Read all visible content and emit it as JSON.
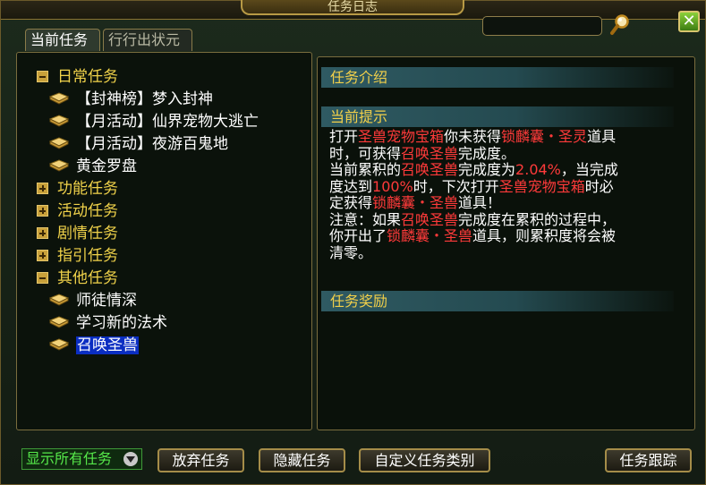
{
  "window": {
    "title": "任务日志"
  },
  "search": {
    "placeholder": ""
  },
  "tabs": [
    {
      "label": "当前任务",
      "active": true
    },
    {
      "label": "行行出状元",
      "active": false
    }
  ],
  "tree": {
    "categories": [
      {
        "label": "日常任务",
        "expanded": true,
        "items": [
          "【封神榜】梦入封神",
          "【月活动】仙界宠物大逃亡",
          "【月活动】夜游百鬼地",
          "黄金罗盘"
        ]
      },
      {
        "label": "功能任务",
        "expanded": false,
        "items": []
      },
      {
        "label": "活动任务",
        "expanded": false,
        "items": []
      },
      {
        "label": "剧情任务",
        "expanded": false,
        "items": []
      },
      {
        "label": "指引任务",
        "expanded": false,
        "items": []
      },
      {
        "label": "其他任务",
        "expanded": true,
        "items": [
          "师徒情深",
          "学习新的法术",
          "召唤圣兽"
        ]
      }
    ],
    "selected_item": "召唤圣兽"
  },
  "detail": {
    "intro_header": "任务介绍",
    "hint_header": "当前提示",
    "reward_header": "任务奖励",
    "hint_segments": [
      {
        "t": "打开",
        "red": false
      },
      {
        "t": "圣兽宠物宝箱",
        "red": true
      },
      {
        "t": "你未获得",
        "red": false
      },
      {
        "t": "锁麟囊・圣灵",
        "red": true
      },
      {
        "t": "道具时，可获得",
        "red": false
      },
      {
        "t": "召唤圣兽",
        "red": true
      },
      {
        "t": "完成度。",
        "red": false
      },
      {
        "t": "当前累积的",
        "red": false
      },
      {
        "t": "召唤圣兽",
        "red": true
      },
      {
        "t": "完成度为",
        "red": false
      },
      {
        "t": "2.04%",
        "red": true
      },
      {
        "t": "，当完成度达到",
        "red": false
      },
      {
        "t": "100%",
        "red": true
      },
      {
        "t": "时，下次打开",
        "red": false
      },
      {
        "t": "圣兽宠物宝箱",
        "red": true
      },
      {
        "t": "时必定获得",
        "red": false
      },
      {
        "t": "锁麟囊・圣兽",
        "red": true
      },
      {
        "t": "道具！",
        "red": false
      },
      {
        "t": "注意：如果",
        "red": false
      },
      {
        "t": "召唤圣兽",
        "red": true
      },
      {
        "t": "完成度在累积的过程中，你开出了",
        "red": false
      },
      {
        "t": "锁麟囊・圣兽",
        "red": true
      },
      {
        "t": "道具，则累积度将会被清零。",
        "red": false
      }
    ]
  },
  "bottom": {
    "filter_label": "显示所有任务",
    "abandon_label": "放弃任务",
    "hide_label": "隐藏任务",
    "custom_category_label": "自定义任务类别",
    "track_label": "任务跟踪"
  },
  "colors": {
    "category_text": "#f0d24a",
    "item_text": "#ffffff",
    "highlight_red": "#ff3a3a",
    "selected_bg": "#0b2ec2",
    "section_bar": "#2f5a62",
    "filter_green": "#56e84a"
  }
}
